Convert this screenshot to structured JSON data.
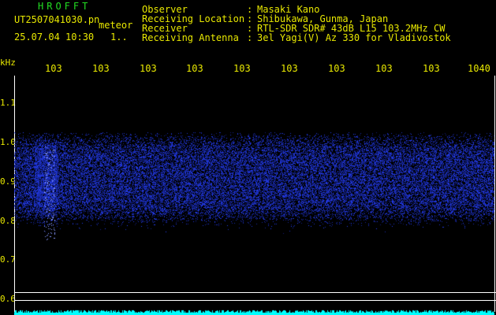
{
  "header": {
    "app_title": "HROFFT",
    "filename": "UT2507041030.pn",
    "datetime": "25.07.04 10:30",
    "counter": "1..",
    "event_type": "meteor",
    "fields": [
      {
        "label": "Observer",
        "value": "Masaki Kano"
      },
      {
        "label": "Receiving Location",
        "value": "Shibukawa, Gunma, Japan"
      },
      {
        "label": "Receiver",
        "value": "RTL-SDR SDR# 43dB L15 103.2MHz CW"
      },
      {
        "label": "Receiving Antenna",
        "value": "3el Yagi(V) Az 330 for Vladivostok"
      }
    ]
  },
  "plot": {
    "y_unit": "kHz",
    "y_ticks": [
      "1.1",
      "1.0",
      "0.9",
      "0.8",
      "0.7",
      "0.6"
    ],
    "x_ticks": [
      "103",
      "103",
      "103",
      "103",
      "103",
      "103",
      "103",
      "103",
      "103",
      "1040"
    ],
    "colors": {
      "signal": "#2233ff",
      "text": "#e8e800",
      "title": "#22dd22",
      "baseline": "#00ffff"
    }
  }
}
